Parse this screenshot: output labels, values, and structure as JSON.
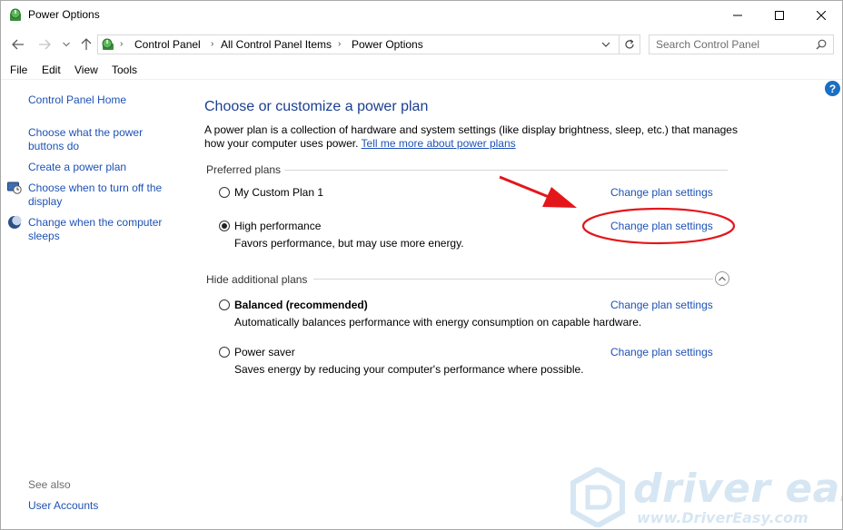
{
  "window": {
    "title": "Power Options",
    "minimize_icon": "minimize-icon",
    "maximize_icon": "maximize-icon",
    "close_icon": "close-icon"
  },
  "navigation": {
    "back_icon": "back-arrow-icon",
    "forward_icon": "forward-arrow-icon",
    "recent_icon": "chevron-down-icon",
    "up_icon": "up-arrow-icon",
    "breadcrumbs": [
      "Control Panel",
      "All Control Panel Items",
      "Power Options"
    ],
    "refresh_icon": "refresh-icon",
    "search_placeholder": "Search Control Panel"
  },
  "menu": [
    "File",
    "Edit",
    "View",
    "Tools"
  ],
  "sidebar": {
    "home": "Control Panel Home",
    "links": [
      "Choose what the power buttons do",
      "Create a power plan",
      "Choose when to turn off the display",
      "Change when the computer sleeps"
    ],
    "see_also_label": "See also",
    "see_also_links": [
      "User Accounts"
    ]
  },
  "main": {
    "title": "Choose or customize a power plan",
    "description": "A power plan is a collection of hardware and system settings (like display brightness, sleep, etc.) that manages how your computer uses power.",
    "learn_more_link": "Tell me more about power plans",
    "preferred_label": "Preferred plans",
    "additional_label": "Hide additional plans",
    "change_link": "Change plan settings",
    "preferred_plans": [
      {
        "name": "My Custom Plan 1",
        "description": "",
        "selected": false
      },
      {
        "name": "High performance",
        "description": "Favors performance, but may use more energy.",
        "selected": true
      }
    ],
    "additional_plans": [
      {
        "name": "Balanced (recommended)",
        "description": "Automatically balances performance with energy consumption on capable hardware.",
        "selected": false
      },
      {
        "name": "Power saver",
        "description": "Saves energy by reducing your computer's performance where possible.",
        "selected": false
      }
    ]
  },
  "annotation": {
    "color": "#e3171b"
  },
  "watermark": {
    "brand": "driver easy",
    "url": "www.DriverEasy.com"
  }
}
